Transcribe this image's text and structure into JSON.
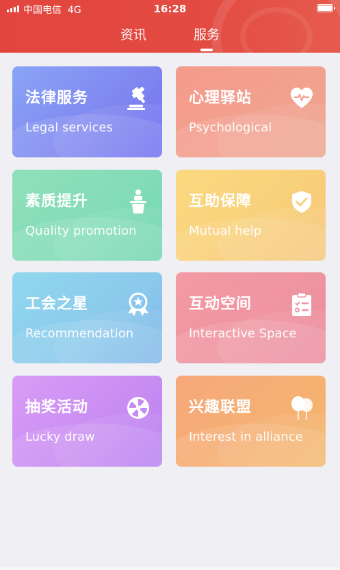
{
  "status_bar": {
    "carrier": "中国电信",
    "network": "4G",
    "time": "16:28"
  },
  "tabs": [
    {
      "label": "资讯",
      "active": false
    },
    {
      "label": "服务",
      "active": true
    }
  ],
  "colors": {
    "header": "#e2453d",
    "background": "#efeff4"
  },
  "cards": [
    {
      "title": "法律服务",
      "subtitle": "Legal services",
      "icon": "gavel-icon"
    },
    {
      "title": "心理驿站",
      "subtitle": "Psychological",
      "icon": "heartbeat-icon"
    },
    {
      "title": "素质提升",
      "subtitle": "Quality promotion",
      "icon": "podium-speaker-icon"
    },
    {
      "title": "互助保障",
      "subtitle": "Mutual help",
      "icon": "shield-check-icon"
    },
    {
      "title": "工会之星",
      "subtitle": "Recommendation",
      "icon": "award-badge-icon"
    },
    {
      "title": "互动空间",
      "subtitle": "Interactive Space",
      "icon": "clipboard-checklist-icon"
    },
    {
      "title": "抽奖活动",
      "subtitle": "Lucky draw",
      "icon": "prize-wheel-icon"
    },
    {
      "title": "兴趣联盟",
      "subtitle": "Interest in alliance",
      "icon": "balloons-icon"
    }
  ]
}
